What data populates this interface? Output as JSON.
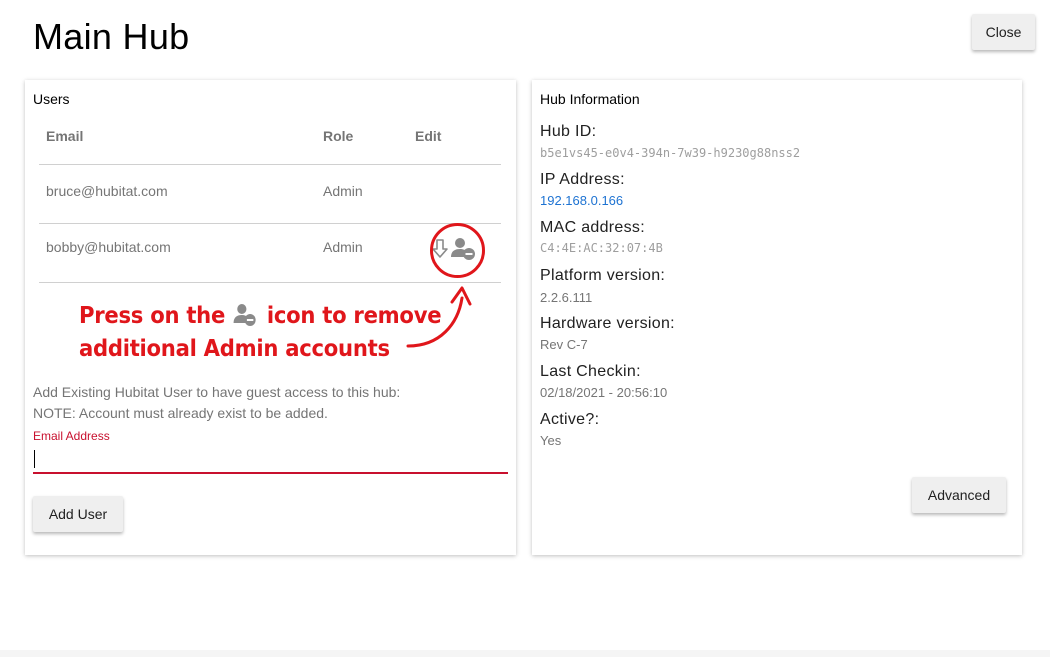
{
  "page": {
    "title": "Main Hub",
    "close_label": "Close"
  },
  "users": {
    "title": "Users",
    "columns": {
      "email": "Email",
      "role": "Role",
      "edit": "Edit"
    },
    "rows": [
      {
        "email": "bruce@hubitat.com",
        "role": "Admin"
      },
      {
        "email": "bobby@hubitat.com",
        "role": "Admin"
      }
    ],
    "annotation": {
      "line1_a": "Press on the",
      "line1_b": "icon to remove",
      "line2": "additional Admin accounts",
      "color": "#e0161b"
    },
    "guest_text_1": "Add Existing Hubitat User to have guest access to this hub:",
    "guest_text_2": "NOTE: Account must already exist to be added.",
    "email_label": "Email Address",
    "email_value": "",
    "add_user_label": "Add User"
  },
  "hub": {
    "title": "Hub Information",
    "fields": [
      {
        "label": "Hub ID:",
        "value": "b5e1vs45-e0v4-394n-7w39-h9230g88nss2"
      },
      {
        "label": "IP Address:",
        "value": "192.168.0.166"
      },
      {
        "label": "MAC address:",
        "value": "C4:4E:AC:32:07:4B"
      },
      {
        "label": "Platform version:",
        "value": "2.2.6.111"
      },
      {
        "label": "Hardware version:",
        "value": "Rev C-7"
      },
      {
        "label": "Last Checkin:",
        "value": "02/18/2021 - 20:56:10"
      },
      {
        "label": "Active?:",
        "value": "Yes"
      }
    ],
    "advanced_label": "Advanced"
  },
  "icons": [
    "arrow-down-outline-icon",
    "remove-user-icon"
  ],
  "colors": {
    "accent_error": "#c8102e",
    "link": "#1e73d2"
  }
}
